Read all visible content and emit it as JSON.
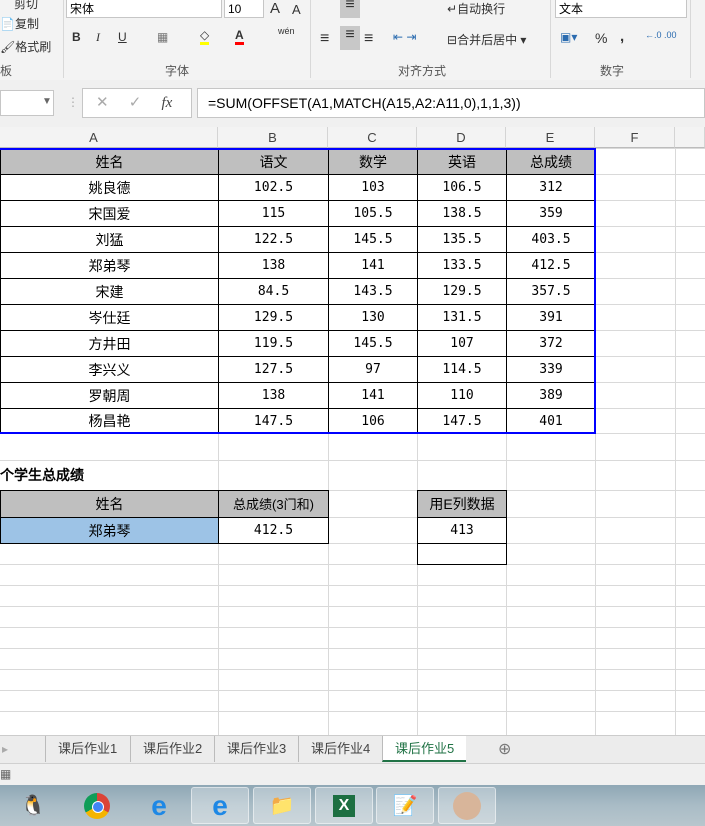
{
  "ribbon": {
    "clipboard": {
      "cut": "剪切",
      "copy": "复制",
      "format_painter": "格式刷",
      "group": "板"
    },
    "font": {
      "name": "宋体",
      "size": "10",
      "bold": "B",
      "italic": "I",
      "underline": "U",
      "group": "字体",
      "phonetic": "wén"
    },
    "align": {
      "wrap": "自动换行",
      "merge": "合并后居中",
      "group": "对齐方式"
    },
    "number": {
      "format": "文本",
      "percent": "%",
      "comma": ",",
      "group": "数字"
    },
    "colors": {
      "highlight": "#ffff00",
      "font_color": "#ff0000"
    }
  },
  "formula_bar": {
    "name_box": "",
    "formula": "=SUM(OFFSET(A1,MATCH(A15,A2:A11,0),1,1,3))",
    "fx": "fx"
  },
  "columns": [
    "A",
    "B",
    "C",
    "D",
    "E",
    "F"
  ],
  "table1": {
    "headers": [
      "姓名",
      "语文",
      "数学",
      "英语",
      "总成绩"
    ],
    "rows": [
      [
        "姚良德",
        "102.5",
        "103",
        "106.5",
        "312"
      ],
      [
        "宋国爱",
        "115",
        "105.5",
        "138.5",
        "359"
      ],
      [
        "刘猛",
        "122.5",
        "145.5",
        "135.5",
        "403.5"
      ],
      [
        "郑弟琴",
        "138",
        "141",
        "133.5",
        "412.5"
      ],
      [
        "宋建",
        "84.5",
        "143.5",
        "129.5",
        "357.5"
      ],
      [
        "岑仕廷",
        "129.5",
        "130",
        "131.5",
        "391"
      ],
      [
        "方井田",
        "119.5",
        "145.5",
        "107",
        "372"
      ],
      [
        "李兴义",
        "127.5",
        "97",
        "114.5",
        "339"
      ],
      [
        "罗朝周",
        "138",
        "141",
        "110",
        "389"
      ],
      [
        "杨昌艳",
        "147.5",
        "106",
        "147.5",
        "401"
      ]
    ]
  },
  "lookup": {
    "title": "个学生总成绩",
    "name_header": "姓名",
    "total_header": "总成绩(3门和)",
    "name_value": "郑弟琴",
    "total_value": "412.5",
    "e_header": "用E列数据",
    "e_value": "413"
  },
  "sheet_tabs": [
    "课后作业1",
    "课后作业2",
    "课后作业3",
    "课后作业4",
    "课后作业5"
  ],
  "active_tab": 4,
  "accent": "#217346",
  "selection_color": "#0000ff",
  "name_fill": "#9dc3e6",
  "header_fill": "#bfbfbf"
}
